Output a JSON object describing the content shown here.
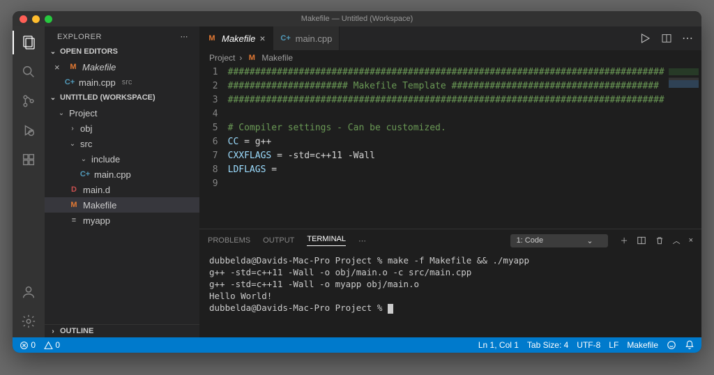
{
  "titlebar": {
    "title": "Makefile — Untitled (Workspace)"
  },
  "sidebar": {
    "title": "EXPLORER",
    "sections": {
      "openEditors": {
        "label": "OPEN EDITORS",
        "items": [
          {
            "name": "Makefile",
            "modified": true,
            "iconLetter": "M"
          },
          {
            "name": "main.cpp",
            "sub": "src",
            "iconLetter": "C+"
          }
        ]
      },
      "workspace": {
        "label": "UNTITLED (WORKSPACE)",
        "tree": {
          "project": "Project",
          "obj": "obj",
          "src": "src",
          "include": "include",
          "maincpp": "main.cpp",
          "maind": "main.d",
          "makefile": "Makefile",
          "myapp": "myapp"
        }
      },
      "outline": {
        "label": "OUTLINE"
      }
    }
  },
  "tabs": [
    {
      "label": "Makefile",
      "iconLetter": "M",
      "active": true,
      "italic": true
    },
    {
      "label": "main.cpp",
      "iconLetter": "C+",
      "active": false
    }
  ],
  "breadcrumb": {
    "parent": "Project",
    "file": "Makefile",
    "fileIcon": "M"
  },
  "code": {
    "lines": [
      {
        "n": 1,
        "kind": "comment",
        "text": "################################################################################"
      },
      {
        "n": 2,
        "kind": "comment",
        "text": "###################### Makefile Template ######################################"
      },
      {
        "n": 3,
        "kind": "comment",
        "text": "################################################################################"
      },
      {
        "n": 4,
        "kind": "blank",
        "text": ""
      },
      {
        "n": 5,
        "kind": "comment",
        "text": "# Compiler settings - Can be customized."
      },
      {
        "n": 6,
        "kind": "assign",
        "var": "CC",
        "rest": " = g++"
      },
      {
        "n": 7,
        "kind": "assign",
        "var": "CXXFLAGS",
        "rest": " = -std=c++11 -Wall"
      },
      {
        "n": 8,
        "kind": "assign",
        "var": "LDFLAGS",
        "rest": " ="
      },
      {
        "n": 9,
        "kind": "blank",
        "text": ""
      }
    ]
  },
  "panel": {
    "tabs": {
      "problems": "PROBLEMS",
      "output": "OUTPUT",
      "terminal": "TERMINAL"
    },
    "selector": "1: Code",
    "terminalLines": [
      "dubbelda@Davids-Mac-Pro Project % make -f Makefile && ./myapp",
      "g++ -std=c++11 -Wall -o obj/main.o -c src/main.cpp",
      "g++ -std=c++11 -Wall -o myapp obj/main.o",
      "Hello World!",
      "dubbelda@Davids-Mac-Pro Project % "
    ]
  },
  "statusbar": {
    "errors": "0",
    "warnings": "0",
    "lncol": "Ln 1, Col 1",
    "tabsize": "Tab Size: 4",
    "encoding": "UTF-8",
    "eol": "LF",
    "lang": "Makefile"
  }
}
